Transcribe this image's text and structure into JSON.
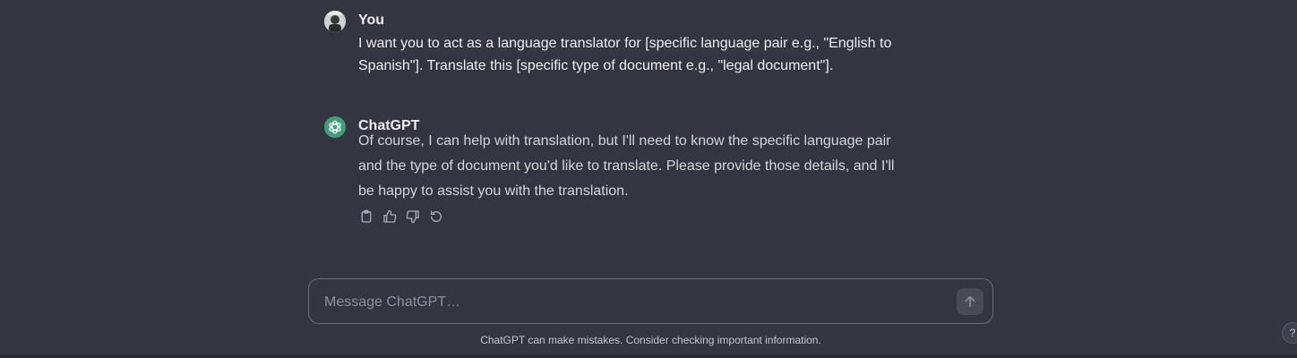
{
  "conversation": {
    "user_message": {
      "author": "You",
      "text_line1": "I want you to act as a language translator for [specific language pair e.g., \"English to",
      "text_line2": "Spanish\"]. Translate this [specific type of document e.g., \"legal document\"].",
      "avatar_icon": "user-avatar-photo"
    },
    "assistant_message": {
      "author": "ChatGPT",
      "text_line1": "Of course, I can help with translation, but I'll need to know the specific language pair",
      "text_line2": "and the type of document you'd like to translate. Please provide those details, and I'll",
      "text_line3": "be happy to assist you with the translation.",
      "avatar_icon": "openai-logo-icon",
      "actions": [
        "copy-icon",
        "thumbs-up-icon",
        "thumbs-down-icon",
        "regenerate-icon"
      ]
    }
  },
  "composer": {
    "placeholder": "Message ChatGPT…",
    "send_icon": "arrow-up-icon"
  },
  "footer": {
    "disclaimer": "ChatGPT can make mistakes. Consider checking important information."
  },
  "help": {
    "label": "?"
  },
  "colors": {
    "background": "#343541",
    "accent_green": "#3ea17a",
    "input_border": "#6b6c7b"
  }
}
